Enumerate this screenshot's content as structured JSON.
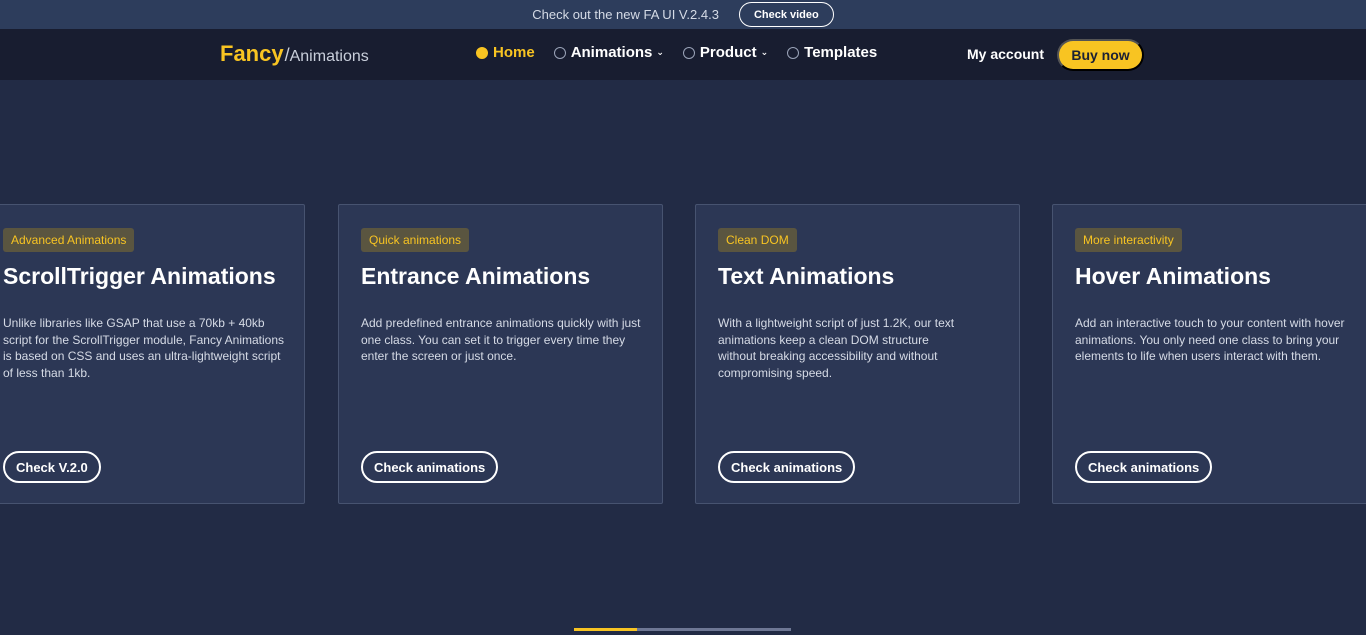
{
  "announcement": {
    "text": "Check out the new FA UI V.2.4.3",
    "button_label": "Check video"
  },
  "logo": {
    "main": "Fancy",
    "separator": "/",
    "sub": "Animations"
  },
  "nav": {
    "items": [
      {
        "label": "Home",
        "active": true,
        "has_dropdown": false
      },
      {
        "label": "Animations",
        "active": false,
        "has_dropdown": true
      },
      {
        "label": "Product",
        "active": false,
        "has_dropdown": true
      },
      {
        "label": "Templates",
        "active": false,
        "has_dropdown": false
      }
    ],
    "account_label": "My account",
    "buy_label": "Buy now"
  },
  "cards": [
    {
      "badge": "Advanced Animations",
      "title": "ScrollTrigger Animations",
      "description": "Unlike libraries like GSAP that use a 70kb + 40kb script for the ScrollTrigger module, Fancy Animations is based on CSS and uses an ultra-lightweight script of less than 1kb.",
      "button": "Check V.2.0"
    },
    {
      "badge": "Quick animations",
      "title": "Entrance Animations",
      "description": "Add predefined entrance animations quickly with just one class. You can set it to trigger every time they enter the screen or just once.",
      "button": "Check animations"
    },
    {
      "badge": "Clean DOM",
      "title": "Text Animations",
      "description": "With a lightweight script of just 1.2K, our text animations keep a clean DOM structure without breaking accessibility and without compromising speed.",
      "button": "Check animations"
    },
    {
      "badge": "More interactivity",
      "title": "Hover Animations",
      "description": "Add an interactive touch to your content with hover animations. You only need one class to bring your elements to life when users interact with them.",
      "button": "Check animations"
    }
  ],
  "carousel": {
    "progress": 0.29
  },
  "colors": {
    "accent": "#f8c422",
    "background": "#222b45",
    "card": "#2c3755",
    "nav": "#181d30"
  },
  "icons": {
    "nav_marker": "circle-dot-icon",
    "dropdown": "chevron-down-icon"
  }
}
